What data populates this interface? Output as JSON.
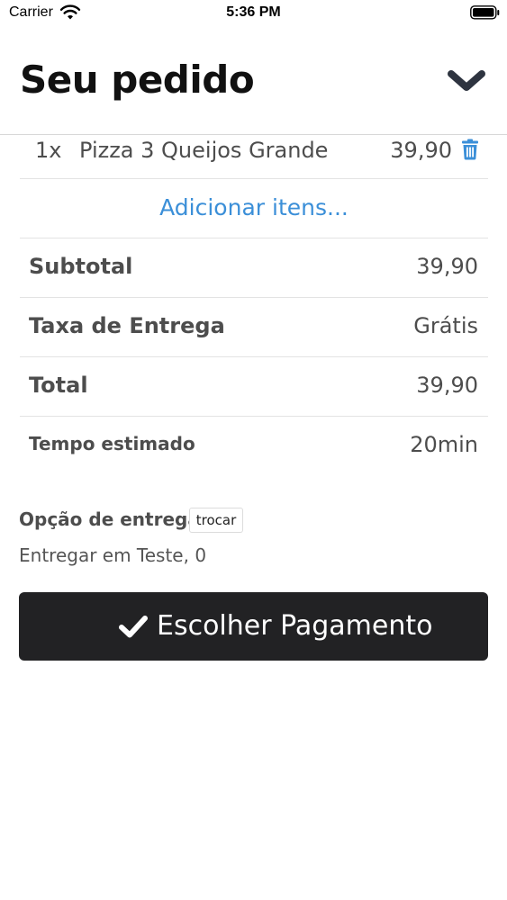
{
  "status_bar": {
    "carrier": "Carrier",
    "time": "5:36 PM"
  },
  "header": {
    "title": "Seu pedido",
    "collapse_icon": "chevron-down-icon"
  },
  "items": [
    {
      "qty": "1x",
      "name": "Pizza 3 Queijos Grande",
      "price": "39,90",
      "delete_icon": "trash-icon"
    }
  ],
  "add_items_label": "Adicionar itens...",
  "summary": {
    "subtotal_label": "Subtotal",
    "subtotal_value": "39,90",
    "delivery_fee_label": "Taxa de Entrega",
    "delivery_fee_value": "Grátis",
    "total_label": "Total",
    "total_value": "39,90",
    "estimated_time_label": "Tempo estimado",
    "estimated_time_value": "20min"
  },
  "delivery": {
    "option_label": "Opção de entrega",
    "change_label": "trocar",
    "address": "Entregar em Teste, 0"
  },
  "checkout": {
    "button_label": "Escolher Pagamento",
    "icon": "check-icon"
  },
  "colors": {
    "link": "#3b8fd8",
    "button_bg": "#222224",
    "chevron": "#2e3440"
  }
}
